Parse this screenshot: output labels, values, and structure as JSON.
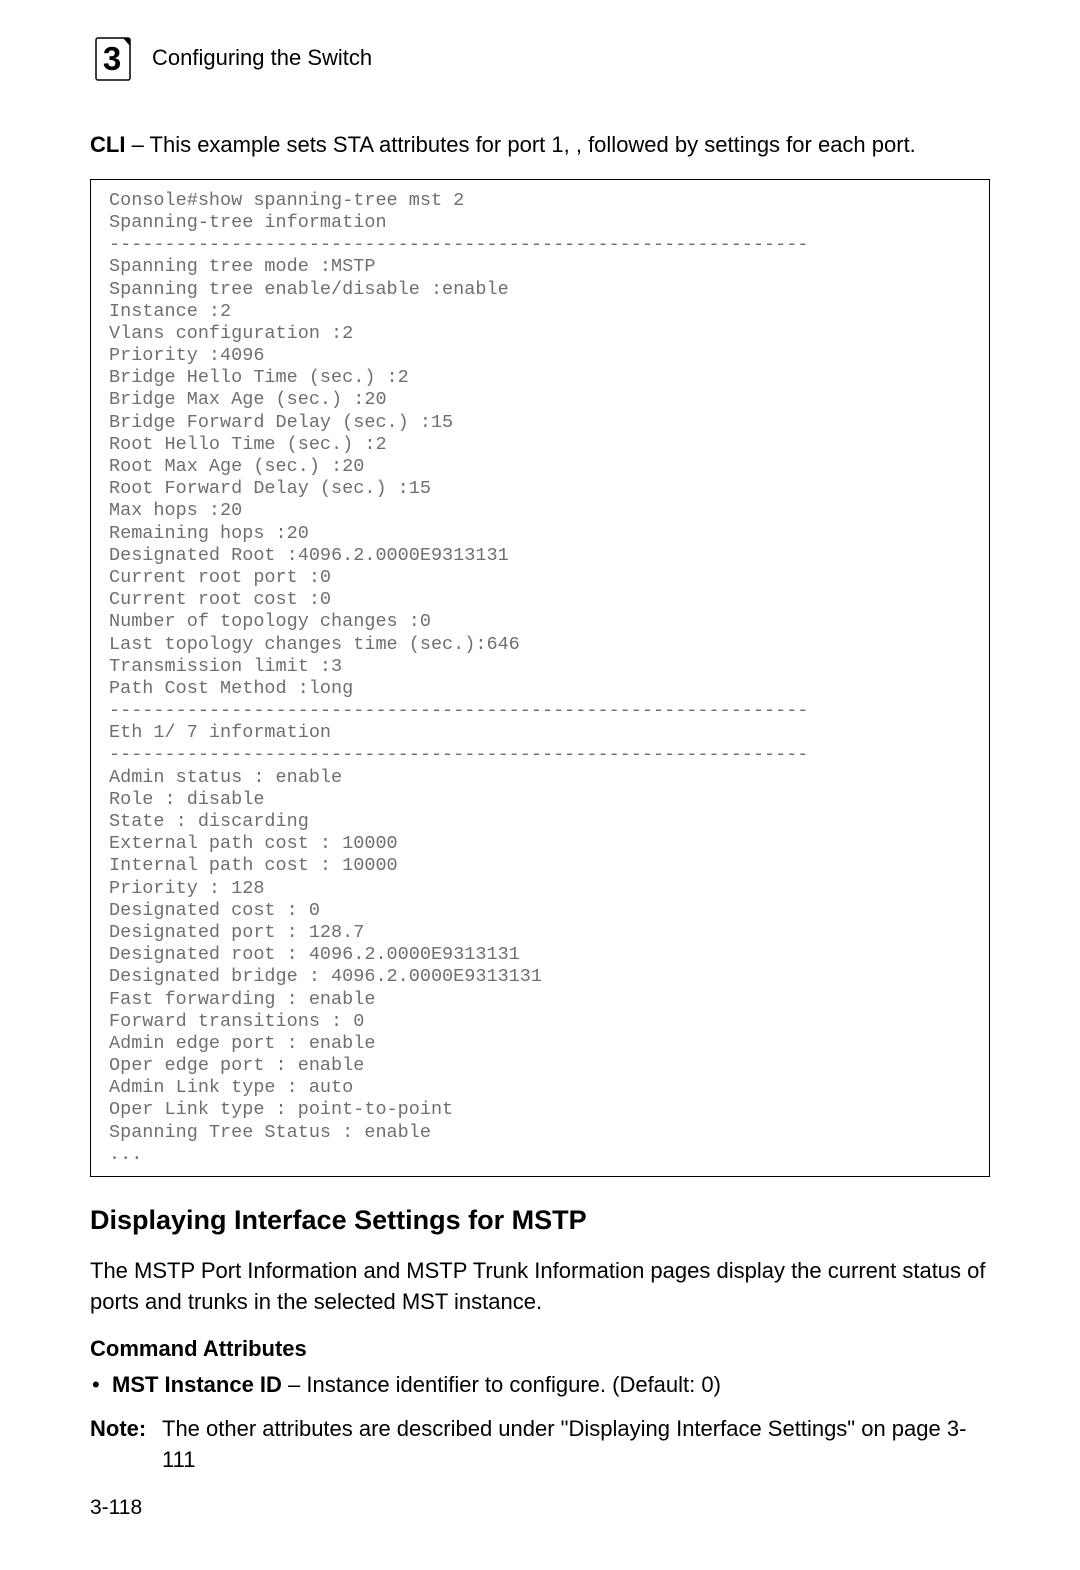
{
  "header": {
    "chapter_number": "3",
    "title": "Configuring the Switch"
  },
  "intro": {
    "lead_bold": "CLI",
    "lead_rest": " – This example sets STA attributes for port 1, , followed by settings for each port."
  },
  "code": "Console#show spanning-tree mst 2\nSpanning-tree information\n---------------------------------------------------------------\nSpanning tree mode :MSTP\nSpanning tree enable/disable :enable\nInstance :2\nVlans configuration :2\nPriority :4096\nBridge Hello Time (sec.) :2\nBridge Max Age (sec.) :20\nBridge Forward Delay (sec.) :15\nRoot Hello Time (sec.) :2\nRoot Max Age (sec.) :20\nRoot Forward Delay (sec.) :15\nMax hops :20\nRemaining hops :20\nDesignated Root :4096.2.0000E9313131\nCurrent root port :0\nCurrent root cost :0\nNumber of topology changes :0\nLast topology changes time (sec.):646\nTransmission limit :3\nPath Cost Method :long\n---------------------------------------------------------------\nEth 1/ 7 information\n---------------------------------------------------------------\nAdmin status : enable\nRole : disable\nState : discarding\nExternal path cost : 10000\nInternal path cost : 10000\nPriority : 128\nDesignated cost : 0\nDesignated port : 128.7\nDesignated root : 4096.2.0000E9313131\nDesignated bridge : 4096.2.0000E9313131\nFast forwarding : enable\nForward transitions : 0\nAdmin edge port : enable\nOper edge port : enable\nAdmin Link type : auto\nOper Link type : point-to-point\nSpanning Tree Status : enable\n...",
  "section": {
    "heading": "Displaying Interface Settings for MSTP",
    "description": "The MSTP Port Information and MSTP Trunk Information pages display the current status of ports and trunks in the selected MST instance.",
    "subheading": "Command Attributes",
    "bullet_bold": "MST Instance ID",
    "bullet_rest": " – Instance identifier to configure. (Default: 0)",
    "note_label": "Note:",
    "note_text": "The other attributes are described under \"Displaying Interface Settings\" on page 3-111"
  },
  "page_number": "3-118"
}
